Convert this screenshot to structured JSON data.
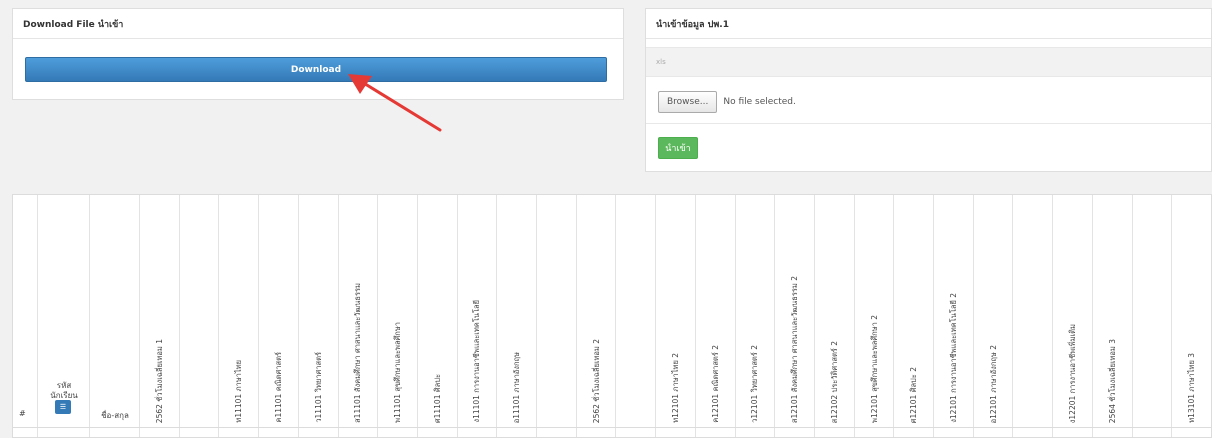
{
  "download_panel": {
    "title": "Download File นำเข้า",
    "button_label": "Download"
  },
  "upload_panel": {
    "title": "นำเข้าข้อมูล ปพ.1",
    "grey_row_text": "xls",
    "browse_label": "Browse...",
    "file_status": "No file selected.",
    "import_label": "นำเข้า"
  },
  "colors": {
    "primary": "#337ab7",
    "success": "#5cb85c",
    "arrow": "#e53935"
  },
  "table": {
    "index_header": "#",
    "student_id_header": "รหัส\nนักเรียน",
    "sort_icon": "☰",
    "name_header": "ชื่อ-สกุล",
    "subject_columns": [
      "2562 ชั่วโมงเฉลี่ยเทอม 1",
      "",
      "ท11101 ภาษาไทย",
      "ค11101 คณิตศาสตร์",
      "ว11101 วิทยาศาสตร์",
      "ส11101 สังคมศึกษา ศาสนาและวัฒนธรรม",
      "พ11101 สุขศึกษาและพลศึกษา",
      "ศ11101 ศิลปะ",
      "ง11101 การงานอาชีพและเทคโนโลยี",
      "อ11101 ภาษาอังกฤษ",
      "",
      "2562 ชั่วโมงเฉลี่ยเทอม 2",
      "",
      "ท12101 ภาษาไทย 2",
      "ค12101 คณิตศาสตร์ 2",
      "ว12101 วิทยาศาสตร์ 2",
      "ส12101 สังคมศึกษา ศาสนาและวัฒนธรรม 2",
      "ส12102 ประวัติศาสตร์ 2",
      "พ12101 สุขศึกษาและพลศึกษา 2",
      "ศ12101 ศิลปะ 2",
      "ง12101 การงานอาชีพและเทคโนโลยี 2",
      "อ12101 ภาษาอังกฤษ 2",
      "",
      "ง12201 การงานอาชีพเพิ่มเติม",
      "2564 ชั่วโมงเฉลี่ยเทอม 3",
      "",
      "ท13101 ภาษาไทย 3"
    ]
  }
}
